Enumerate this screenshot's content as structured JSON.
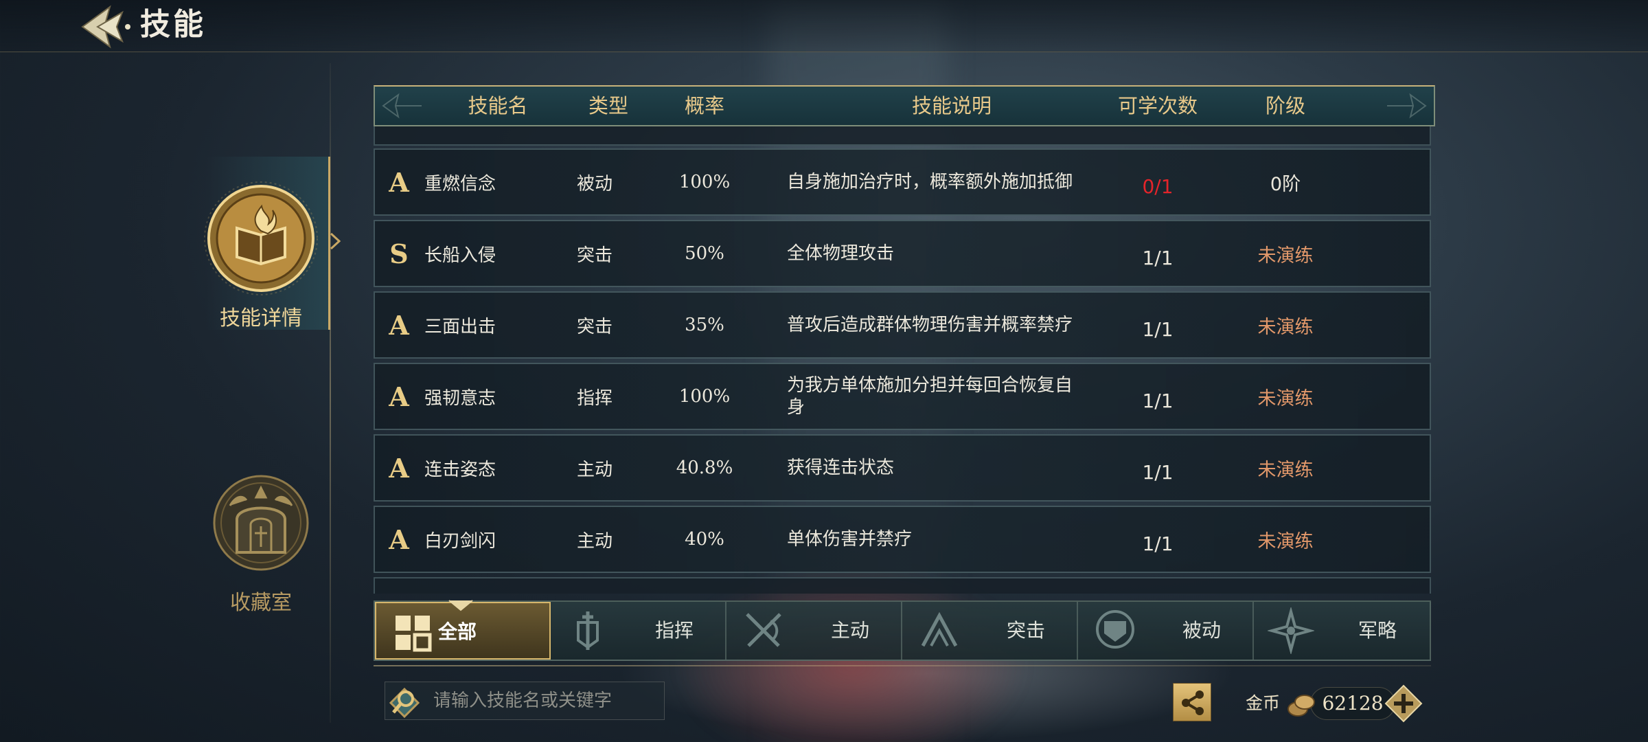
{
  "header": {
    "title": "技能"
  },
  "sidebar": {
    "items": [
      {
        "label": "技能详情",
        "icon": "flame-book-emblem-icon",
        "active": true
      },
      {
        "label": "收藏室",
        "icon": "shrine-emblem-icon",
        "active": false
      }
    ]
  },
  "table": {
    "columns": [
      "技能名",
      "类型",
      "概率",
      "技能说明",
      "可学次数",
      "阶级"
    ],
    "rows": [
      {
        "grade": "A",
        "name": "重燃信念",
        "type": "被动",
        "prob": "100%",
        "desc": "自身施加治疗时，概率额外施加抵御",
        "learn": "0/1",
        "learn_color": "red",
        "stage": "0阶",
        "stage_color": "white"
      },
      {
        "grade": "S",
        "name": "长船入侵",
        "type": "突击",
        "prob": "50%",
        "desc": "全体物理攻击",
        "learn": "1/1",
        "learn_color": "white",
        "stage": "未演练",
        "stage_color": "orange"
      },
      {
        "grade": "A",
        "name": "三面出击",
        "type": "突击",
        "prob": "35%",
        "desc": "普攻后造成群体物理伤害并概率禁疗",
        "learn": "1/1",
        "learn_color": "white",
        "stage": "未演练",
        "stage_color": "orange"
      },
      {
        "grade": "A",
        "name": "强韧意志",
        "type": "指挥",
        "prob": "100%",
        "desc": "为我方单体施加分担并每回合恢复自身",
        "learn": "1/1",
        "learn_color": "white",
        "stage": "未演练",
        "stage_color": "orange"
      },
      {
        "grade": "A",
        "name": "连击姿态",
        "type": "主动",
        "prob": "40.8%",
        "desc": "获得连击状态",
        "learn": "1/1",
        "learn_color": "white",
        "stage": "未演练",
        "stage_color": "orange"
      },
      {
        "grade": "A",
        "name": "白刃剑闪",
        "type": "主动",
        "prob": "40%",
        "desc": "单体伤害并禁疗",
        "learn": "1/1",
        "learn_color": "white",
        "stage": "未演练",
        "stage_color": "orange"
      }
    ]
  },
  "filters": {
    "tabs": [
      {
        "label": "全部",
        "icon": "grid-icon",
        "active": true
      },
      {
        "label": "指挥",
        "icon": "banner-sword-icon",
        "active": false
      },
      {
        "label": "主动",
        "icon": "crossed-swords-icon",
        "active": false
      },
      {
        "label": "突击",
        "icon": "arrow-chevron-icon",
        "active": false
      },
      {
        "label": "被动",
        "icon": "shield-icon",
        "active": false
      },
      {
        "label": "军略",
        "icon": "compass-star-icon",
        "active": false
      }
    ]
  },
  "search": {
    "placeholder": "请输入技能名或关键字",
    "value": ""
  },
  "currency": {
    "label": "金币",
    "value": "62128"
  },
  "colors": {
    "gold": "#e8c98a",
    "red": "#e4242a",
    "orange": "#e2986a"
  }
}
